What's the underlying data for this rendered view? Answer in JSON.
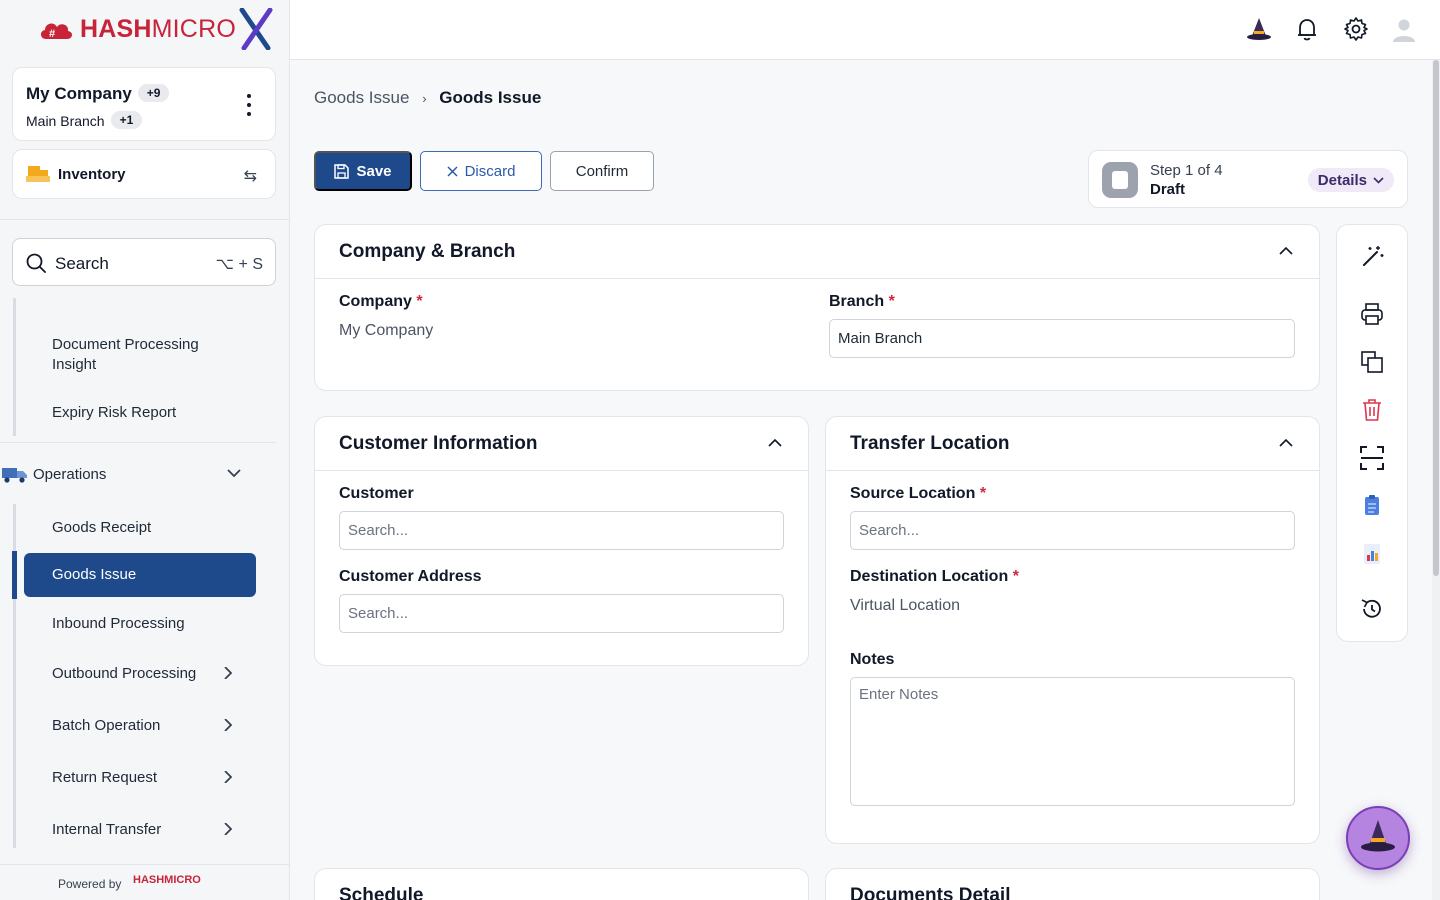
{
  "sidebar": {
    "logo_text_prefix": "HASH",
    "logo_text_suffix": "MICRO",
    "company": {
      "name": "My Company",
      "company_badge": "+9",
      "branch": "Main Branch",
      "branch_badge": "+1"
    },
    "module": {
      "label": "Inventory"
    },
    "search": {
      "label": "Search",
      "shortcut": "⌥ + S"
    },
    "items_top": [
      "Document Processing Insight",
      "Expiry Risk Report"
    ],
    "section": {
      "label": "Operations"
    },
    "items": [
      {
        "label": "Goods Receipt",
        "has_children": false
      },
      {
        "label": "Goods Issue",
        "has_children": false,
        "active": true
      },
      {
        "label": "Inbound Processing",
        "has_children": false
      },
      {
        "label": "Outbound Processing",
        "has_children": true
      },
      {
        "label": "Batch Operation",
        "has_children": true
      },
      {
        "label": "Return Request",
        "has_children": true
      },
      {
        "label": "Internal Transfer",
        "has_children": true
      }
    ],
    "powered_by": "Powered by",
    "powered_logo": "HASHMICRO"
  },
  "topbar": {
    "icons": [
      "wizard-hat-icon",
      "bell-icon",
      "gear-icon",
      "avatar-icon"
    ]
  },
  "breadcrumb": {
    "parent": "Goods Issue",
    "current": "Goods Issue"
  },
  "toolbar": {
    "save_label": "Save",
    "discard_label": "Discard",
    "confirm_label": "Confirm"
  },
  "step": {
    "count": "Step 1 of 4",
    "status": "Draft",
    "details_label": "Details"
  },
  "company_branch": {
    "title": "Company & Branch",
    "company_label": "Company",
    "company_value": "My Company",
    "branch_label": "Branch",
    "branch_value": "Main Branch"
  },
  "customer_info": {
    "title": "Customer Information",
    "customer_label": "Customer",
    "customer_placeholder": "Search...",
    "address_label": "Customer Address",
    "address_placeholder": "Search..."
  },
  "transfer_location": {
    "title": "Transfer Location",
    "source_label": "Source Location",
    "source_placeholder": "Search...",
    "destination_label": "Destination Location",
    "destination_value": "Virtual Location",
    "notes_label": "Notes",
    "notes_placeholder": "Enter Notes"
  },
  "bottom_sections": {
    "schedule_title": "Schedule",
    "documents_title": "Documents Detail"
  },
  "colors": {
    "brand": "#1e4a8c",
    "logo_red": "#c7243a",
    "required": "#d3263e",
    "delete": "#e0364c"
  }
}
